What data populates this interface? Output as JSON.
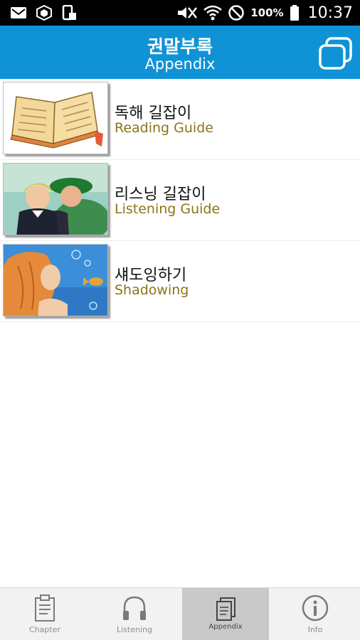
{
  "status_bar": {
    "battery": "100%",
    "time": "10:37",
    "icons": [
      "mail-icon",
      "app-cube-icon",
      "device-icon",
      "mute-icon",
      "wifi-icon",
      "do-not-disturb-icon",
      "battery-icon"
    ]
  },
  "header": {
    "title_ko": "권말부록",
    "title_en": "Appendix",
    "action_icon": "copy-icon"
  },
  "items": [
    {
      "title_ko": "독해 길잡이",
      "title_en": "Reading Guide"
    },
    {
      "title_ko": "리스닝 길잡이",
      "title_en": "Listening Guide"
    },
    {
      "title_ko": "섀도잉하기",
      "title_en": "Shadowing"
    }
  ],
  "tabs": [
    {
      "label": "Chapter",
      "icon": "clipboard-icon",
      "active": false
    },
    {
      "label": "Listening",
      "icon": "headphones-icon",
      "active": false
    },
    {
      "label": "Appendix",
      "icon": "copy-icon",
      "active": true
    },
    {
      "label": "Info",
      "icon": "info-icon",
      "active": false
    }
  ],
  "colors": {
    "header": "#0f93d6",
    "subtitle_gold": "#8b7415",
    "active_tab": "#c9c9c9"
  }
}
